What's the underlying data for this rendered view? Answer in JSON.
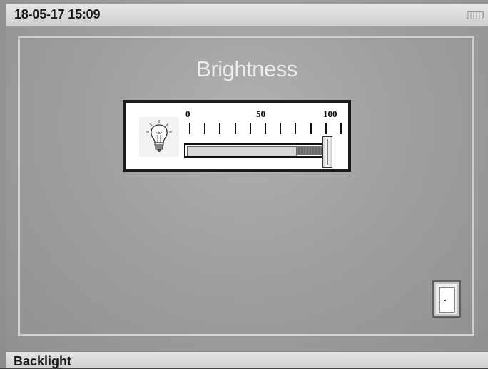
{
  "status_bar": {
    "datetime": "18-05-17 15:09",
    "battery_icon": "battery-icon"
  },
  "page": {
    "title": "Brightness"
  },
  "brightness_panel": {
    "bulb_icon": "lightbulb-icon",
    "scale_labels": [
      "0",
      "50",
      "100"
    ],
    "scale_min": 0,
    "scale_max": 100,
    "slider_value_fraction": 0.97
  },
  "exit_button": {
    "icon": "door-icon"
  },
  "bottom_bar": {
    "label": "Backlight"
  },
  "colors": {
    "background": "#9e9e9e",
    "frame": "#cfcfcf",
    "title": "#ececec",
    "panel": "#ffffff",
    "panel_border": "#1b1b1b"
  }
}
